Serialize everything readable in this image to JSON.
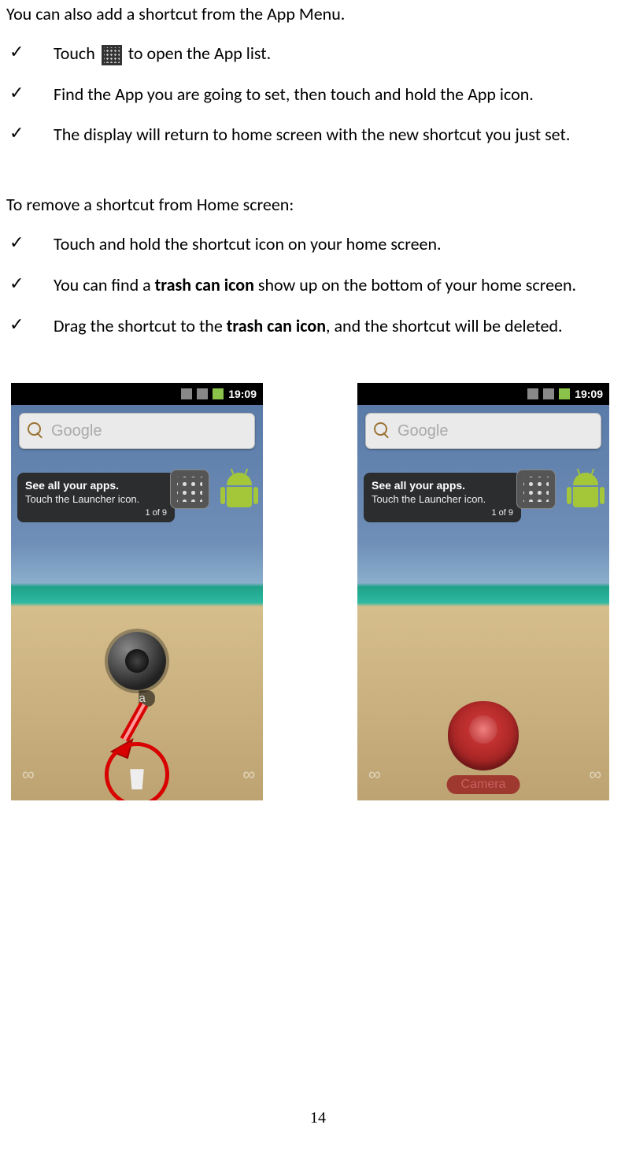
{
  "intro": "You can also add a shortcut from the App Menu.",
  "list1": {
    "item1_pre": "Touch ",
    "item1_post": " to open the App list.",
    "item2": "Find the App you are going to set, then touch and hold the App icon.",
    "item3": "The display will return to home screen with the new shortcut you just set."
  },
  "subheading": "To remove a shortcut from Home screen:",
  "list2": {
    "item1": "Touch and hold the shortcut icon on your home screen.",
    "item2_pre": "You can find a ",
    "item2_bold": "trash can icon",
    "item2_post": " show up on the bottom of your home screen.",
    "item3_pre": "Drag the shortcut to the ",
    "item3_bold": "trash can icon",
    "item3_post": ", and the shortcut will be deleted."
  },
  "phone": {
    "time": "19:09",
    "search_placeholder": "Google",
    "tip_title": "See all your apps.",
    "tip_body": "Touch the Launcher icon.",
    "tip_count": "1 of 9",
    "camera_label_partial": "era",
    "camera_label_full": "Camera"
  },
  "page_number": "14"
}
